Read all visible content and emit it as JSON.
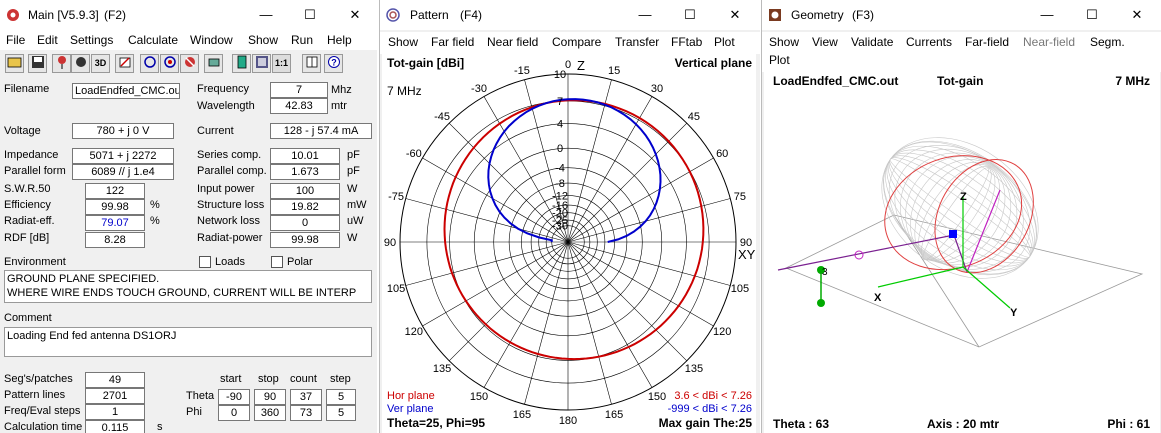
{
  "main": {
    "title": "Main [V5.9.3]",
    "shortcut": "(F2)",
    "menu": [
      "File",
      "Edit",
      "Settings",
      "Calculate",
      "Window",
      "Show",
      "Run",
      "Help"
    ],
    "toolbar": [
      "folder-icon",
      "save-icon",
      "antenna-icon",
      "3d-icon",
      "edit-icon",
      "pattern-icon",
      "freq-icon",
      "options-icon",
      "calc-icon",
      "table-icon",
      "one-to-one-icon",
      "book-icon",
      "help-icon"
    ],
    "toolbar_labels": {
      "threed": "3D",
      "one": "1:1"
    },
    "filename_label": "Filename",
    "filename": "LoadEndfed_CMC.ou",
    "frequency_label": "Frequency",
    "frequency": "7",
    "frequency_unit": "Mhz",
    "wavelength_label": "Wavelength",
    "wavelength": "42.83",
    "wavelength_unit": "mtr",
    "voltage_label": "Voltage",
    "voltage": "780 + j 0 V",
    "current_label": "Current",
    "current": "128 - j 57.4 mA",
    "impedance_label": "Impedance",
    "impedance": "5071 + j 2272",
    "parallel_label": "Parallel form",
    "parallel": "6089 // j 1.e4",
    "series_comp_label": "Series comp.",
    "series_comp": "10.01",
    "series_comp_unit": "pF",
    "parallel_comp_label": "Parallel comp.",
    "parallel_comp": "1.673",
    "parallel_comp_unit": "pF",
    "swr_label": "S.W.R.50",
    "swr": "122",
    "input_power_label": "Input power",
    "input_power": "100",
    "input_power_unit": "W",
    "efficiency_label": "Efficiency",
    "efficiency": "99.98",
    "efficiency_unit": "%",
    "structure_loss_label": "Structure loss",
    "structure_loss": "19.82",
    "structure_loss_unit": "mW",
    "radiat_eff_label": "Radiat-eff.",
    "radiat_eff": "79.07",
    "radiat_eff_unit": "%",
    "network_loss_label": "Network loss",
    "network_loss": "0",
    "network_loss_unit": "uW",
    "rdf_label": "RDF [dB]",
    "rdf": "8.28",
    "radiat_power_label": "Radiat-power",
    "radiat_power": "99.98",
    "radiat_power_unit": "W",
    "environment_label": "Environment",
    "loads_label": "Loads",
    "polar_label": "Polar",
    "environment_line1": "GROUND PLANE SPECIFIED.",
    "environment_line2": "WHERE WIRE ENDS TOUCH GROUND, CURRENT WILL BE INTERP",
    "comment_label": "Comment",
    "comment": "Loading End fed antenna DS1ORJ",
    "segs_label": "Seg's/patches",
    "segs": "49",
    "pattern_lines_label": "Pattern lines",
    "pattern_lines": "2701",
    "freq_steps_label": "Freq/Eval steps",
    "freq_steps": "1",
    "calc_time_label": "Calculation time",
    "calc_time": "0.115",
    "calc_time_unit": "s",
    "col_start": "start",
    "col_stop": "stop",
    "col_count": "count",
    "col_step": "step",
    "theta_label": "Theta",
    "theta_start": "-90",
    "theta_stop": "90",
    "theta_count": "37",
    "theta_step": "5",
    "phi_label": "Phi",
    "phi_start": "0",
    "phi_stop": "360",
    "phi_count": "73",
    "phi_step": "5"
  },
  "pattern": {
    "title": "Pattern",
    "shortcut": "(F4)",
    "menu": [
      "Show",
      "Far field",
      "Near field",
      "Compare",
      "Transfer",
      "FFtab",
      "Plot"
    ],
    "header_left": "Tot-gain [dBi]",
    "header_right": "Vertical plane",
    "freq": "7 MHz",
    "z_label": "Z",
    "xy_label": "XY",
    "angle_labels": [
      "0",
      "15",
      "30",
      "45",
      "60",
      "75",
      "90",
      "105",
      "120",
      "135",
      "150",
      "165",
      "180",
      "165",
      "150",
      "135",
      "120",
      "105",
      "90",
      "-75",
      "-60",
      "-45",
      "-30",
      "-15"
    ],
    "gain_labels": [
      "10",
      "7",
      "4",
      "0",
      "-4",
      "-8",
      "-12",
      "-16",
      "-20",
      "-25",
      "-30"
    ],
    "legend": [
      {
        "name": "Hor plane",
        "range": "3.6 < dBi < 7.26",
        "color": "#cc0000"
      },
      {
        "name": "Ver plane",
        "range": "-999 < dBi < 7.26",
        "color": "#0000cc"
      }
    ],
    "footer_left": "Theta=25, Phi=95",
    "footer_right": "Max gain The:25"
  },
  "geometry": {
    "title": "Geometry",
    "shortcut": "(F3)",
    "menu": [
      "Show",
      "View",
      "Validate",
      "Currents",
      "Far-field",
      "Near-field",
      "Segm.",
      "Plot"
    ],
    "file": "LoadEndfed_CMC.out",
    "mode": "Tot-gain",
    "freq": "7 MHz",
    "axis_x": "X",
    "axis_y": "Y",
    "axis_z": "Z",
    "seg_label": "3",
    "theta_footer": "Theta : 63",
    "axis_footer": "Axis : 20 mtr",
    "phi_footer": "Phi : 61"
  }
}
